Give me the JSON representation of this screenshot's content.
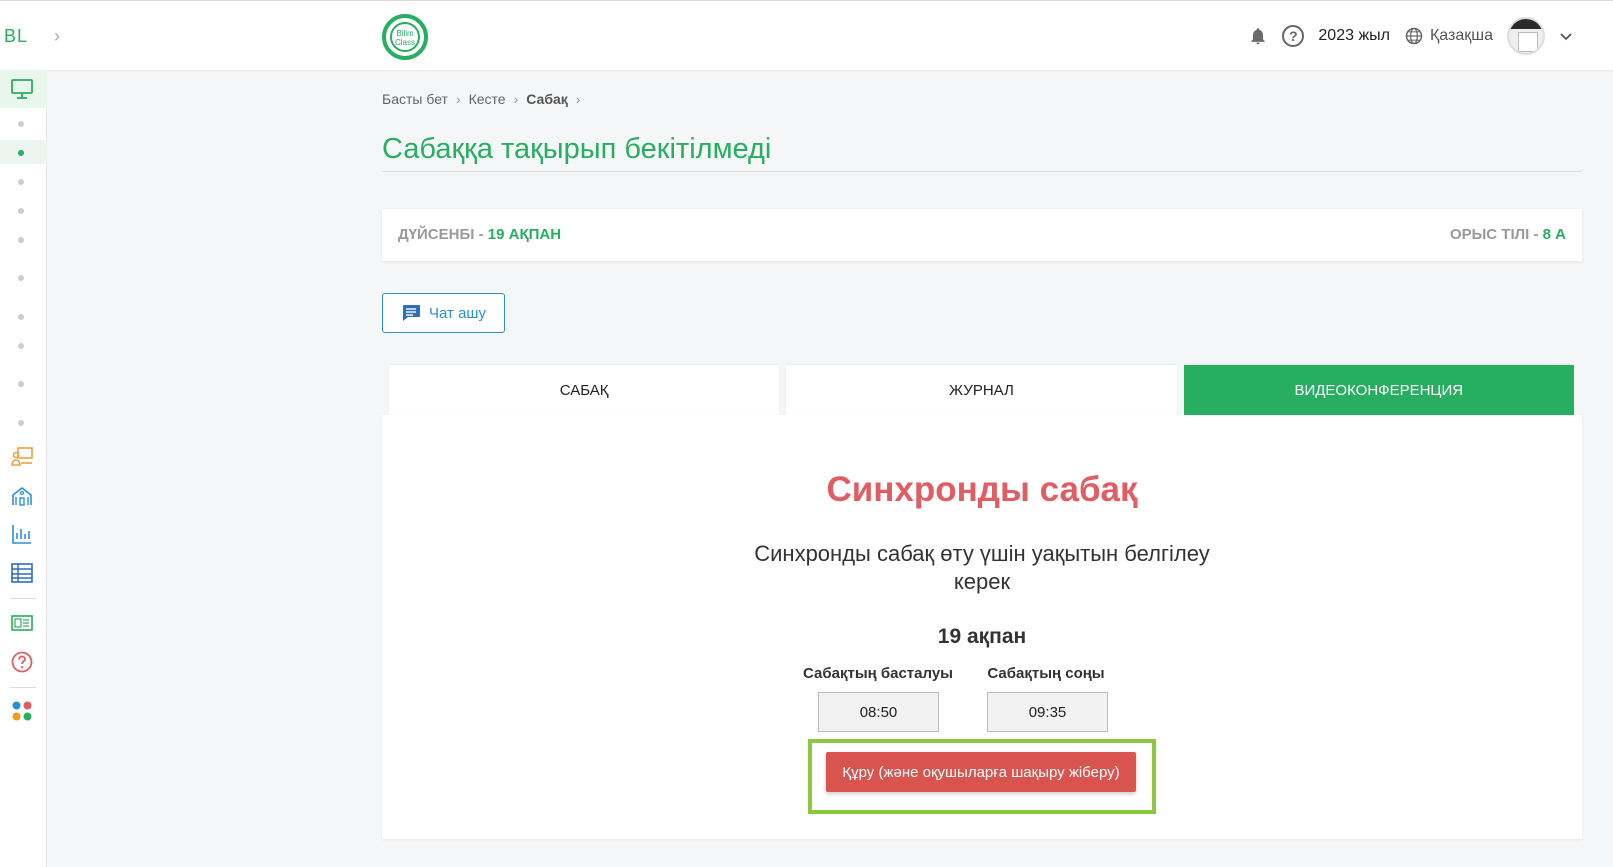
{
  "header": {
    "side_logo": "BL",
    "brand_text": "Bilim Class",
    "year": "2023 жыл",
    "language": "Қазақша",
    "icons": [
      "bell-icon",
      "help-icon",
      "globe-icon",
      "chevron-down-icon"
    ]
  },
  "breadcrumb": {
    "items": [
      "Басты бет",
      "Кесте",
      "Сабақ"
    ]
  },
  "page": {
    "title": "Сабаққа тақырып бекітілмеді"
  },
  "date_card": {
    "day": "ДҮЙСЕНБІ - ",
    "date": "19 АҚПАН",
    "subject": "ОРЫС ТІЛІ - ",
    "class": "8 А"
  },
  "chat_button": {
    "label": "Чат ашу"
  },
  "tabs": [
    {
      "label": "САБАҚ",
      "active": false
    },
    {
      "label": "ЖУРНАЛ",
      "active": false
    },
    {
      "label": "ВИДЕОКОНФЕРЕНЦИЯ",
      "active": true
    }
  ],
  "sync": {
    "title": "Синхронды сабақ",
    "description": "Синхронды сабақ өту үшін уақытын белгілеу керек",
    "date": "19 ақпан",
    "start_label": "Сабақтың басталуы",
    "end_label": "Сабақтың соңы",
    "start_time": "08:50",
    "end_time": "09:35",
    "create_button": "Құру (және оқушыларға шақыру жіберу)"
  },
  "colors": {
    "primary_green": "#27ae60",
    "accent_red": "#e25c64",
    "button_red": "#d9534f",
    "link_blue": "#2d8fd6",
    "highlight": "#8dc63f"
  }
}
